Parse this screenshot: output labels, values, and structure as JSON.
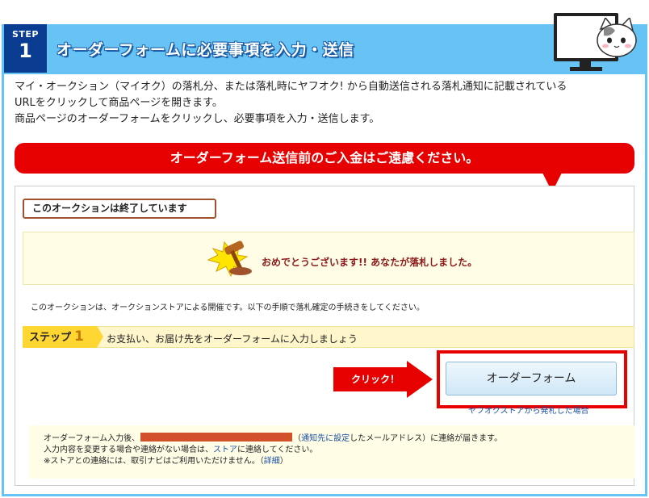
{
  "header": {
    "step_word": "STEP",
    "step_number": "1",
    "title": "オーダーフォームに必要事項を入力・送信",
    "accent_color": "#67c3f3",
    "badge_color": "#0a3d91"
  },
  "intro": {
    "line1": "マイ・オークション（マイオク）の落札分、または落札時にヤフオク! から自動送信される落札通知に記載されている",
    "line2": "URLをクリックして商品ページを開きます。",
    "line3": "商品ページのオーダーフォームをクリックし、必要事項を入力・送信します。"
  },
  "banner": {
    "text": "オーダーフォーム送信前のご入金はご遠慮ください。",
    "color": "#e60000"
  },
  "auction": {
    "ended_label": "このオークションは終了しています",
    "congrats": "おめでとうございます!!  あなたが落札しました。",
    "store_note": "このオークションは、オークションストアによる開催です。以下の手順で落札確定の手続きをしてください。",
    "step_label": "ステップ",
    "step_number": "1",
    "step_text": "お支払い、お届け先をオーダーフォームに入力しましょう",
    "click_label": "クリック！",
    "order_button": "オーダーフォーム",
    "store_link": "ヤフオクストアから発札した場合"
  },
  "info": {
    "l1_prefix": "オーダーフォーム入力後、",
    "l1_paren_open": "（",
    "l1_link": "通知先に設定",
    "l1_suffix": "したメールアドレス）に連絡が届きます。",
    "l2_prefix": "入力内容を変更する場合や連絡がない場合は、",
    "l2_link": "ストア",
    "l2_suffix": "に連絡してください。",
    "l3_prefix": "※ストアとの連絡には、取引ナビはご利用いただけません。（",
    "l3_link": "詳細",
    "l3_suffix": "）"
  }
}
